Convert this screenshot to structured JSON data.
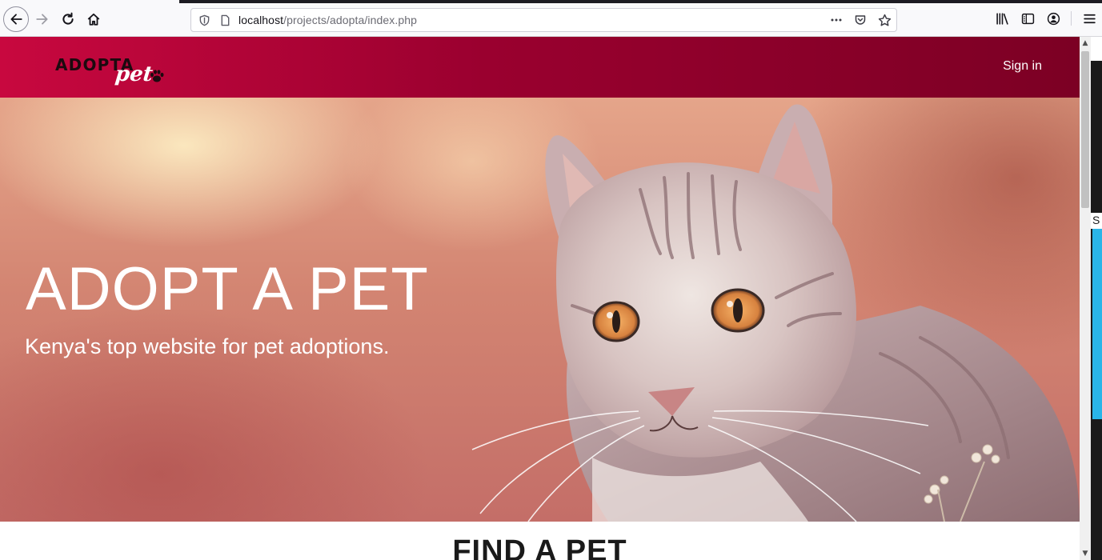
{
  "browser": {
    "url_host": "localhost",
    "url_path": "/projects/adopta/index.php"
  },
  "site": {
    "logo_word": "ADOPTA",
    "logo_pet": "pet",
    "signin_label": "Sign in",
    "header_gradient": [
      "#c8083f",
      "#7c0024"
    ]
  },
  "hero": {
    "title": "ADOPT A PET",
    "subtitle": "Kenya's top website for pet adoptions."
  },
  "section": {
    "title": "FIND A PET"
  },
  "background_window": {
    "visible_char": "S"
  },
  "icons": [
    "back-icon",
    "forward-icon",
    "reload-icon",
    "home-icon",
    "shield-icon",
    "page-icon",
    "more-icon",
    "pocket-icon",
    "bookmark-star-icon",
    "library-icon",
    "sidebar-icon",
    "account-icon",
    "menu-icon",
    "paw-icon"
  ]
}
